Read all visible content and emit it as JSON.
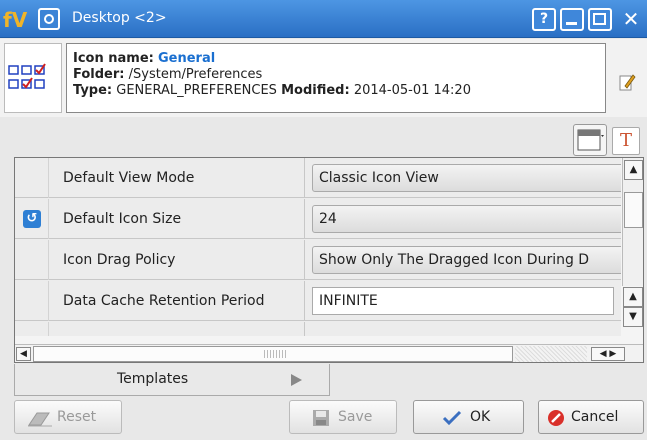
{
  "window": {
    "title": "Desktop <2>",
    "help_label": "?",
    "close_label": "✕"
  },
  "info": {
    "name_label": "Icon name:",
    "name_value": "General",
    "folder_label": "Folder:",
    "folder_value": "/System/Preferences",
    "type_label": "Type:",
    "type_value": "GENERAL_PREFERENCES",
    "modified_label": "Modified:",
    "modified_value": "2014-05-01 14:20"
  },
  "toolstrip": {
    "text_button": "T"
  },
  "properties": [
    {
      "label": "Default View Mode",
      "value": "Classic Icon View",
      "modified": false
    },
    {
      "label": "Default Icon Size",
      "value": "24",
      "modified": true
    },
    {
      "label": "Icon Drag Policy",
      "value": "Show Only The Dragged Icon During D",
      "modified": false
    },
    {
      "label": "Data Cache Retention Period",
      "value": "INFINITE",
      "modified": false
    }
  ],
  "tabs": [
    {
      "label": "Templates"
    }
  ],
  "buttons": {
    "reset": "Reset",
    "save": "Save",
    "ok": "OK",
    "cancel": "Cancel"
  },
  "colors": {
    "titlebar": "#2a6fc4",
    "name_accent": "#1a6fd0",
    "ok_check": "#3b6fc0",
    "cancel_red": "#d9302a"
  }
}
